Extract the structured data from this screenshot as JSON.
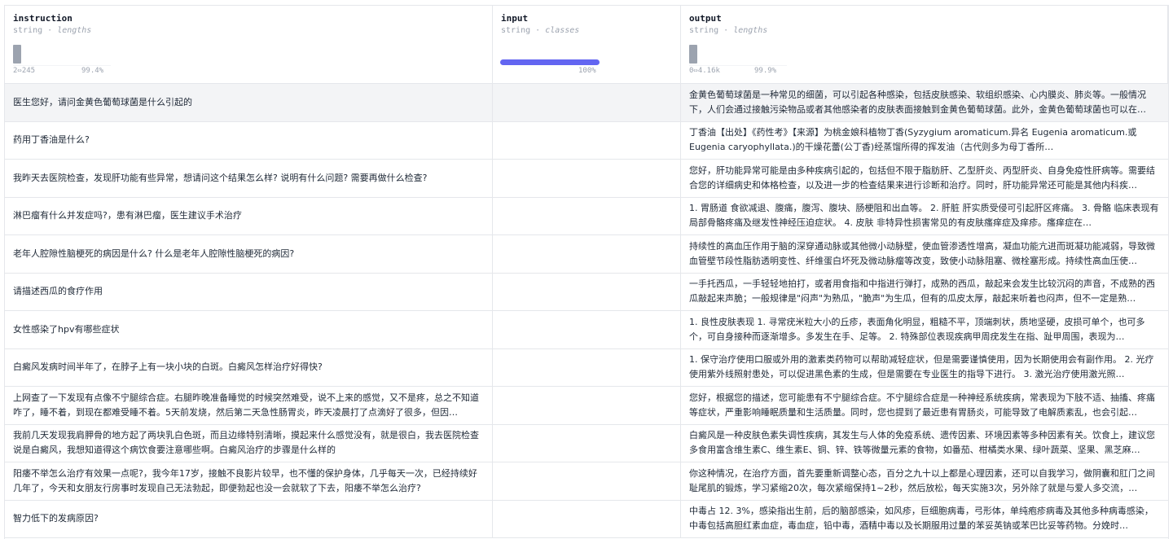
{
  "columns": [
    {
      "name": "instruction",
      "type": "string",
      "stat": "lengths",
      "min": "2",
      "max": "245",
      "pct": "99.4%"
    },
    {
      "name": "input",
      "type": "string",
      "stat": "classes",
      "pct": "100%"
    },
    {
      "name": "output",
      "type": "string",
      "stat": "lengths",
      "min": "0",
      "max": "4.16k",
      "pct": "99.9%"
    }
  ],
  "rows": [
    {
      "instruction": "医生您好，请问金黄色葡萄球菌是什么引起的",
      "input": "",
      "output": "金黄色葡萄球菌是一种常见的细菌，可以引起各种感染，包括皮肤感染、软组织感染、心内膜炎、肺炎等。一般情况下，人们会通过接触污染物品或者其他感染者的皮肤表面接触到金黄色葡萄球菌。此外，金黄色葡萄球菌也可以在…"
    },
    {
      "instruction": "药用丁香油是什么?",
      "input": "",
      "output": "丁香油【出处】《药性考》【来源】为桃金娘科植物丁香(Syzygium aromaticum.异名 Eugenia aromaticum.或 Eugenia caryophyllata.)的干燥花蕾(公丁香)经蒸馏所得的挥发油（古代则多为母丁香所…"
    },
    {
      "instruction": "我昨天去医院检查，发现肝功能有些异常，想请问这个结果怎么样? 说明有什么问题? 需要再做什么检查?",
      "input": "",
      "output": "您好，肝功能异常可能是由多种疾病引起的，包括但不限于脂肪肝、乙型肝炎、丙型肝炎、自身免疫性肝病等。需要结合您的详细病史和体格检查，以及进一步的检查结果来进行诊断和治疗。同时，肝功能异常还可能是其他内科疾…"
    },
    {
      "instruction": "淋巴瘤有什么并发症吗?，患有淋巴瘤，医生建议手术治疗",
      "input": "",
      "output": "1. 胃肠道 食欲减退、腹痛，腹泻、腹块、肠梗阻和出血等。 2. 肝脏 肝实质受侵可引起肝区疼痛。 3. 骨骼 临床表现有局部骨骼疼痛及继发性神经压迫症状。 4. 皮肤 非特异性损害常见的有皮肤瘙痒症及痒疹。瘙痒症在…"
    },
    {
      "instruction": "老年人腔隙性脑梗死的病因是什么? 什么是老年人腔隙性脑梗死的病因?",
      "input": "",
      "output": "持续性的高血压作用于脑的深穿通动脉或其他微小动脉壁，使血管渗透性增高，凝血功能亢进而斑凝功能减弱，导致微血管壁节段性脂肪透明变性、纤维蛋白坏死及微动脉瘤等改变，致使小动脉阻塞、微栓塞形成。持续性高血压使…"
    },
    {
      "instruction": "请描述西瓜的食疗作用",
      "input": "",
      "output": "一手托西瓜，一手轻轻地拍打，或者用食指和中指进行弹打，成熟的西瓜，敲起来会发生比较沉闷的声音，不成熟的西瓜敲起来声脆；一般规律是\"闷声\"为熟瓜，\"脆声\"为生瓜，但有的瓜皮太厚，敲起来听着也闷声，但不一定是熟…"
    },
    {
      "instruction": "女性感染了hpv有哪些症状",
      "input": "",
      "output": "1. 良性皮肤表现 1. 寻常疣米粒大小的丘疹，表面角化明显，粗糙不平，顶端刺状，质地坚硬，皮损可单个，也可多个，可自身接种而逐渐增多。多发生在手、足等。 2. 特殊部位表现疾病甲周疣发生在指、趾甲周围，表现为…"
    },
    {
      "instruction": "白癜风发病时间半年了，在脖子上有一块小块的白斑。白癜风怎样治疗好得快?",
      "input": "",
      "output": "1. 保守治疗使用口服或外用的激素类药物可以帮助减轻症状，但是需要谨慎使用，因为长期使用会有副作用。 2. 光疗使用紫外线照射患处，可以促进黑色素的生成，但是需要在专业医生的指导下进行。 3. 激光治疗使用激光照…"
    },
    {
      "instruction": "上网查了一下发现有点像不宁腿综合症。右腿昨晚准备睡觉的时候突然难受，说不上来的感觉，又不是疼，总之不知道咋了，睡不着，到现在都难受睡不着。5天前发烧，然后第二天急性肠胃炎，昨天凌晨打了点滴好了很多，但因…",
      "input": "",
      "output": "您好，根据您的描述，您可能患有不宁腿综合症。不宁腿综合症是一种神经系统疾病，常表现为下肢不适、抽搐、疼痛等症状，严重影响睡眠质量和生活质量。同时，您也提到了最近患有胃肠炎，可能导致了电解质紊乱，也会引起…"
    },
    {
      "instruction": "我前几天发现我肩胛骨的地方起了两块乳白色斑，而且边缘特别清晰，摸起来什么感觉没有，就是很白，我去医院检查说是白癜风，我想知道得这个病饮食要注意哪些啊。白癜风治疗的步骤是什么样的",
      "input": "",
      "output": "白癜风是一种皮肤色素失调性疾病，其发生与人体的免疫系统、遗传因素、环境因素等多种因素有关。饮食上，建议您多食用富含维生素C、维生素E、铜、锌、铁等微量元素的食物，如番茄、柑橘类水果、绿叶蔬菜、坚果、黑芝麻…"
    },
    {
      "instruction": "阳痿不举怎么治疗有效果一点呢?，我今年17岁，接触不良影片较早，也不懂的保护身体，几乎每天一次，已经持续好几年了，今天和女朋友行房事时发现自己无法勃起，即便勃起也没一会就软了下去，阳痿不举怎么治疗?",
      "input": "",
      "output": "你这种情况，在治疗方面，首先要重新调整心态，百分之九十以上都是心理因素，还可以自我学习，做阴囊和肛门之间耻尾肌的锻炼，学习紧缩20次，每次紧缩保持1~2秒，然后放松，每天实施3次，另外除了就是与爱人多交流，…"
    },
    {
      "instruction": "智力低下的发病原因?",
      "input": "",
      "output": "中毒占 12. 3%，感染指出生前，后的脑部感染，如风疹，巨细胞病毒，弓形体，单纯疱疹病毒及其他多种病毒感染，中毒包括高胆红素血症，毒血症，铅中毒，酒精中毒以及长期服用过量的苯妥英钠或苯巴比妥等药物。分娩时…"
    }
  ]
}
